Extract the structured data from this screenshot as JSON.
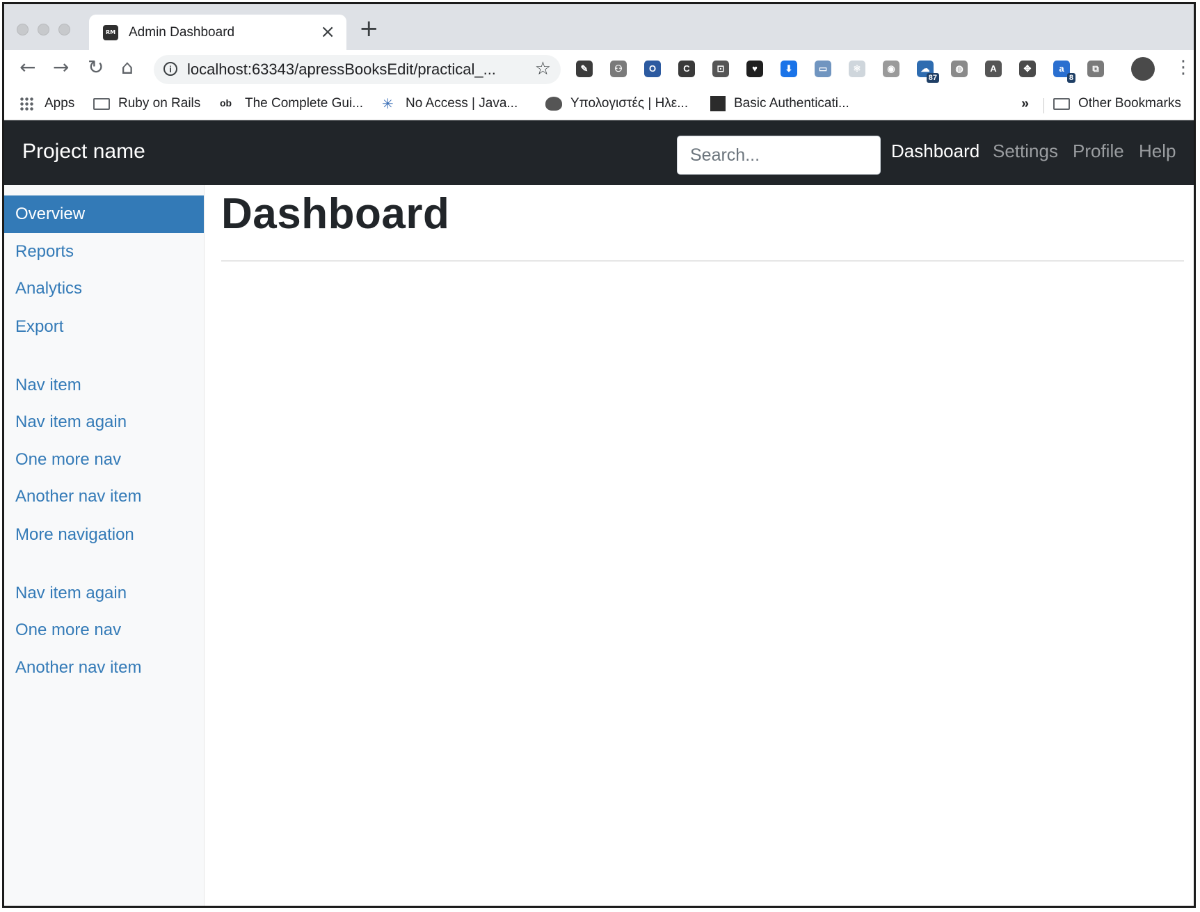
{
  "browser": {
    "tab_title": "Admin Dashboard",
    "tab_favicon_text": "RM",
    "close_glyph": "×",
    "new_tab_glyph": "+",
    "url": "localhost:63343/apressBooksEdit/practical_...",
    "info_glyph": "i",
    "star_glyph": "☆",
    "back_glyph": "←",
    "forward_glyph": "→",
    "reload_glyph": "↻",
    "home_glyph": "⌂",
    "menu_glyph": "⋮",
    "extensions": [
      {
        "name": "eyedropper",
        "color": "#3b3b3b",
        "text": "✎"
      },
      {
        "name": "network",
        "color": "#7a7a7a",
        "text": "⚇"
      },
      {
        "name": "opera",
        "color": "#2c5aa0",
        "text": "O"
      },
      {
        "name": "c",
        "color": "#3a3a3a",
        "text": "C"
      },
      {
        "name": "focus",
        "color": "#555555",
        "text": "⊡"
      },
      {
        "name": "lightbulb",
        "color": "#1f1f1f",
        "text": "♥"
      },
      {
        "name": "download",
        "color": "#1a73e8",
        "text": "⬇"
      },
      {
        "name": "window",
        "color": "#7095c0",
        "text": "▭"
      },
      {
        "name": "react",
        "color": "#cfd6dc",
        "text": "⚛"
      },
      {
        "name": "camera",
        "color": "#9a9a9a",
        "text": "◉"
      },
      {
        "name": "cloud",
        "color": "#2e6cb0",
        "text": "☁",
        "badge": "87"
      },
      {
        "name": "globe",
        "color": "#8a8a8a",
        "text": "◍"
      },
      {
        "name": "a-circle",
        "color": "#555555",
        "text": "A"
      },
      {
        "name": "move",
        "color": "#4a4a4a",
        "text": "✥"
      },
      {
        "name": "a-badge",
        "color": "#2a6fd0",
        "text": "a",
        "badge": "8"
      },
      {
        "name": "cast",
        "color": "#7a7a7a",
        "text": "⧉"
      }
    ],
    "bookmarks": [
      {
        "label": "Apps",
        "icon": "apps"
      },
      {
        "label": "Ruby on Rails",
        "icon": "folder"
      },
      {
        "label": "The Complete Gui...",
        "icon": "ob",
        "icon_text": "ob"
      },
      {
        "label": "No Access | Java...",
        "icon": "sparkle"
      },
      {
        "label": "Υπολογιστές | Ηλε...",
        "icon": "balloon"
      },
      {
        "label": "Basic Authenticati...",
        "icon": "diamond"
      }
    ],
    "overflow_glyph": "»",
    "other_bookmarks": "Other Bookmarks"
  },
  "navbar": {
    "brand": "Project name",
    "search_placeholder": "Search...",
    "links": [
      {
        "label": "Dashboard",
        "active": true
      },
      {
        "label": "Settings",
        "active": false
      },
      {
        "label": "Profile",
        "active": false
      },
      {
        "label": "Help",
        "active": false
      }
    ]
  },
  "sidebar": {
    "items": [
      {
        "label": "Overview",
        "active": true
      },
      {
        "label": "Reports"
      },
      {
        "label": "Analytics"
      },
      {
        "label": "Export"
      },
      {
        "label": "Nav item"
      },
      {
        "label": "Nav item again"
      },
      {
        "label": "One more nav"
      },
      {
        "label": "Another nav item"
      },
      {
        "label": "More navigation"
      },
      {
        "label": "Nav item again"
      },
      {
        "label": "One more nav"
      },
      {
        "label": "Another nav item"
      }
    ]
  },
  "main": {
    "title": "Dashboard"
  }
}
